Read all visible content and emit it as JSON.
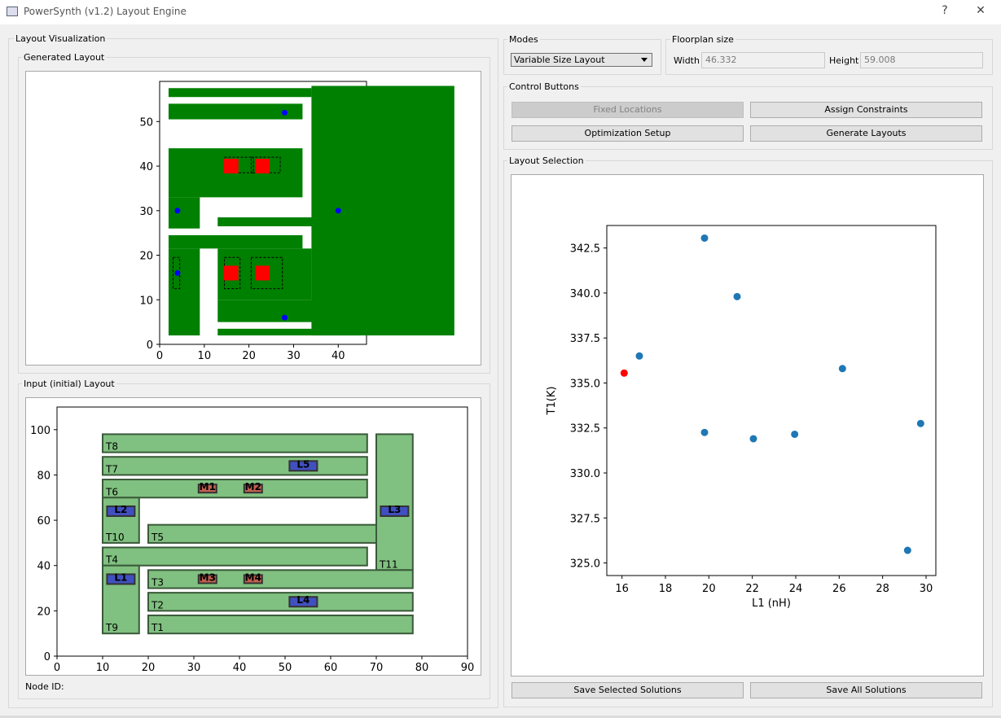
{
  "window": {
    "title": "PowerSynth (v1.2) Layout Engine",
    "help": "?",
    "close": "✕"
  },
  "groups": {
    "layout_visualization": "Layout Visualization",
    "generated_layout": "Generated Layout",
    "input_layout": "Input (initial) Layout",
    "modes": "Modes",
    "floorplan": "Floorplan size",
    "control_buttons": "Control Buttons",
    "layout_selection": "Layout Selection"
  },
  "modes": {
    "selected": "Variable Size Layout"
  },
  "floorplan": {
    "width_label": "Width",
    "width_value": "46.332",
    "height_label": "Height",
    "height_value": "59.008"
  },
  "buttons": {
    "fixed_locations": "Fixed Locations",
    "assign_constraints": "Assign Constraints",
    "optimization_setup": "Optimization Setup",
    "generate_layouts": "Generate Layouts",
    "save_selected": "Save Selected Solutions",
    "save_all": "Save All Solutions"
  },
  "node_id_label": "Node ID:",
  "colors": {
    "trace_green": "#008000",
    "die_red": "#ff0000",
    "lead_blue": "#0000ff",
    "input_trace": "#80c080",
    "input_die": "#c06050",
    "input_lead": "#4050c0",
    "point_blue": "#1f77b4",
    "point_selected": "#ff0000"
  },
  "chart_data": [
    {
      "type": "scatter",
      "name_note": "Generated Layout",
      "xlim": [
        0,
        46.332
      ],
      "ylim": [
        0,
        59.008
      ],
      "xticks": [
        "0",
        "10",
        "20",
        "30",
        "40"
      ],
      "yticks": [
        "0",
        "10",
        "20",
        "30",
        "40",
        "50"
      ],
      "traces": [
        [
          2,
          55.5,
          32,
          2
        ],
        [
          2,
          50.5,
          30,
          3.5
        ],
        [
          2,
          33,
          30,
          11
        ],
        [
          2,
          26,
          7,
          7
        ],
        [
          13,
          26.5,
          25,
          2
        ],
        [
          34,
          2,
          32,
          56
        ],
        [
          2,
          21.5,
          30,
          3
        ],
        [
          2,
          2,
          7,
          19.5
        ],
        [
          13,
          10,
          21,
          11.5
        ],
        [
          13,
          5,
          32,
          5
        ],
        [
          13,
          2,
          32,
          1.5
        ]
      ],
      "dies": [
        [
          16,
          40
        ],
        [
          23,
          40
        ],
        [
          16,
          16
        ],
        [
          23,
          16
        ]
      ],
      "die_outlines": [
        [
          14.5,
          38.5,
          6.5,
          3.5
        ],
        [
          20.5,
          38.5,
          6.5,
          3.5
        ],
        [
          14.5,
          12.5,
          3.5,
          7
        ],
        [
          20.5,
          12.5,
          7,
          7
        ],
        [
          3,
          12.5,
          1.5,
          7
        ]
      ],
      "leads": [
        [
          28,
          52
        ],
        [
          4,
          30
        ],
        [
          40,
          30
        ],
        [
          4,
          16
        ],
        [
          28,
          6
        ]
      ]
    },
    {
      "type": "scatter",
      "name_note": "Input (initial) Layout",
      "xlim": [
        0,
        90
      ],
      "ylim": [
        0,
        110
      ],
      "xticks": [
        "0",
        "10",
        "20",
        "30",
        "40",
        "50",
        "60",
        "70",
        "80",
        "90"
      ],
      "yticks": [
        "0",
        "20",
        "40",
        "60",
        "80",
        "100"
      ],
      "traces": [
        {
          "id": "T8",
          "x": 10,
          "y": 90,
          "w": 58,
          "h": 8
        },
        {
          "id": "T7",
          "x": 10,
          "y": 80,
          "w": 58,
          "h": 8
        },
        {
          "id": "T6",
          "x": 10,
          "y": 70,
          "w": 58,
          "h": 8
        },
        {
          "id": "T10",
          "x": 10,
          "y": 50,
          "w": 8,
          "h": 20
        },
        {
          "id": "T5",
          "x": 20,
          "y": 50,
          "w": 50,
          "h": 8
        },
        {
          "id": "T4",
          "x": 10,
          "y": 40,
          "w": 58,
          "h": 8
        },
        {
          "id": "T11",
          "x": 70,
          "y": 38,
          "w": 8,
          "h": 60
        },
        {
          "id": "T3",
          "x": 20,
          "y": 30,
          "w": 58,
          "h": 8
        },
        {
          "id": "T2",
          "x": 20,
          "y": 20,
          "w": 58,
          "h": 8
        },
        {
          "id": "T9",
          "x": 10,
          "y": 10,
          "w": 8,
          "h": 30
        },
        {
          "id": "T1",
          "x": 20,
          "y": 10,
          "w": 58,
          "h": 8
        }
      ],
      "parts": [
        {
          "id": "M1",
          "kind": "die",
          "x": 33,
          "y": 74
        },
        {
          "id": "M2",
          "kind": "die",
          "x": 43,
          "y": 74
        },
        {
          "id": "M3",
          "kind": "die",
          "x": 33,
          "y": 34
        },
        {
          "id": "M4",
          "kind": "die",
          "x": 43,
          "y": 34
        },
        {
          "id": "L5",
          "kind": "lead",
          "x": 54,
          "y": 84
        },
        {
          "id": "L2",
          "kind": "lead",
          "x": 14,
          "y": 64
        },
        {
          "id": "L3",
          "kind": "lead",
          "x": 74,
          "y": 64
        },
        {
          "id": "L1",
          "kind": "lead",
          "x": 14,
          "y": 34
        },
        {
          "id": "L4",
          "kind": "lead",
          "x": 54,
          "y": 24
        }
      ]
    },
    {
      "type": "scatter",
      "name_note": "Layout Selection",
      "xlabel": "L1 (nH)",
      "ylabel": "T1(K)",
      "xlim": [
        15.3,
        30.45
      ],
      "ylim": [
        324.3,
        343.75
      ],
      "xticks": [
        16,
        18,
        20,
        22,
        24,
        26,
        28,
        30
      ],
      "yticks": [
        325.0,
        327.5,
        330.0,
        332.5,
        335.0,
        337.5,
        340.0,
        342.5
      ],
      "points": [
        {
          "x": 16.1,
          "y": 335.55,
          "selected": true
        },
        {
          "x": 16.8,
          "y": 336.5
        },
        {
          "x": 19.8,
          "y": 343.05
        },
        {
          "x": 21.3,
          "y": 339.8
        },
        {
          "x": 19.8,
          "y": 332.25
        },
        {
          "x": 22.05,
          "y": 331.9
        },
        {
          "x": 23.95,
          "y": 332.15
        },
        {
          "x": 26.15,
          "y": 335.8
        },
        {
          "x": 29.15,
          "y": 325.7
        },
        {
          "x": 29.75,
          "y": 332.75
        }
      ]
    }
  ]
}
